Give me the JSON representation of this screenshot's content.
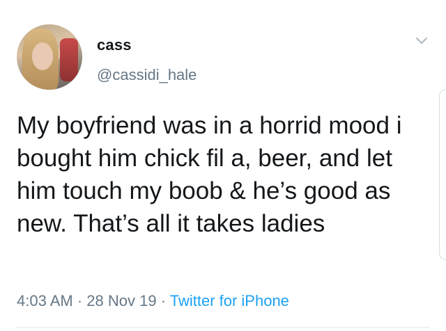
{
  "user": {
    "display_name": "cass",
    "handle": "@cassidi_hale"
  },
  "tweet": {
    "text": "My boyfriend was in a horrid mood i bought him chick fil a, beer, and let him touch my boob & he’s good as new. That’s all it takes ladies",
    "time": "4:03 AM",
    "date": "28 Nov 19",
    "source": "Twitter for iPhone",
    "separator": " · "
  },
  "colors": {
    "text": "#14171a",
    "muted": "#657786",
    "link": "#1da1f2"
  },
  "icons": {
    "menu": "chevron-down-icon"
  }
}
